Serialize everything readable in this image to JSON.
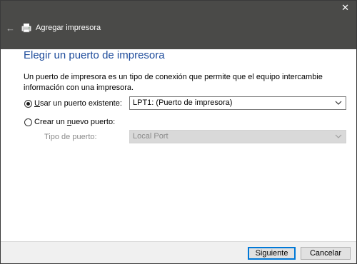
{
  "window": {
    "close_glyph": "✕",
    "back_glyph": "←",
    "title": "Agregar impresora"
  },
  "main": {
    "heading": "Elegir un puerto de impresora",
    "description": "Un puerto de impresora es un tipo de conexión que permite que el equipo intercambie información con una impresora.",
    "use_existing": {
      "label_key": "U",
      "label_rest": "sar un puerto existente:",
      "selected": true,
      "value": "LPT1: (Puerto de impresora)"
    },
    "create_new": {
      "label_pre": "Crear un ",
      "label_key": "n",
      "label_rest": "uevo puerto:",
      "selected": false
    },
    "port_type": {
      "label": "Tipo de puerto:",
      "value": "Local Port",
      "enabled": false
    }
  },
  "footer": {
    "next_label": "Siguiente",
    "cancel_label": "Cancelar"
  },
  "icons": {
    "back": "back-arrow-icon",
    "printer": "printer-icon",
    "close": "close-icon",
    "dropdown": "chevron-down-icon"
  },
  "colors": {
    "titlebar": "#4a4a48",
    "heading": "#1d4b9b",
    "accent": "#0078d7"
  }
}
